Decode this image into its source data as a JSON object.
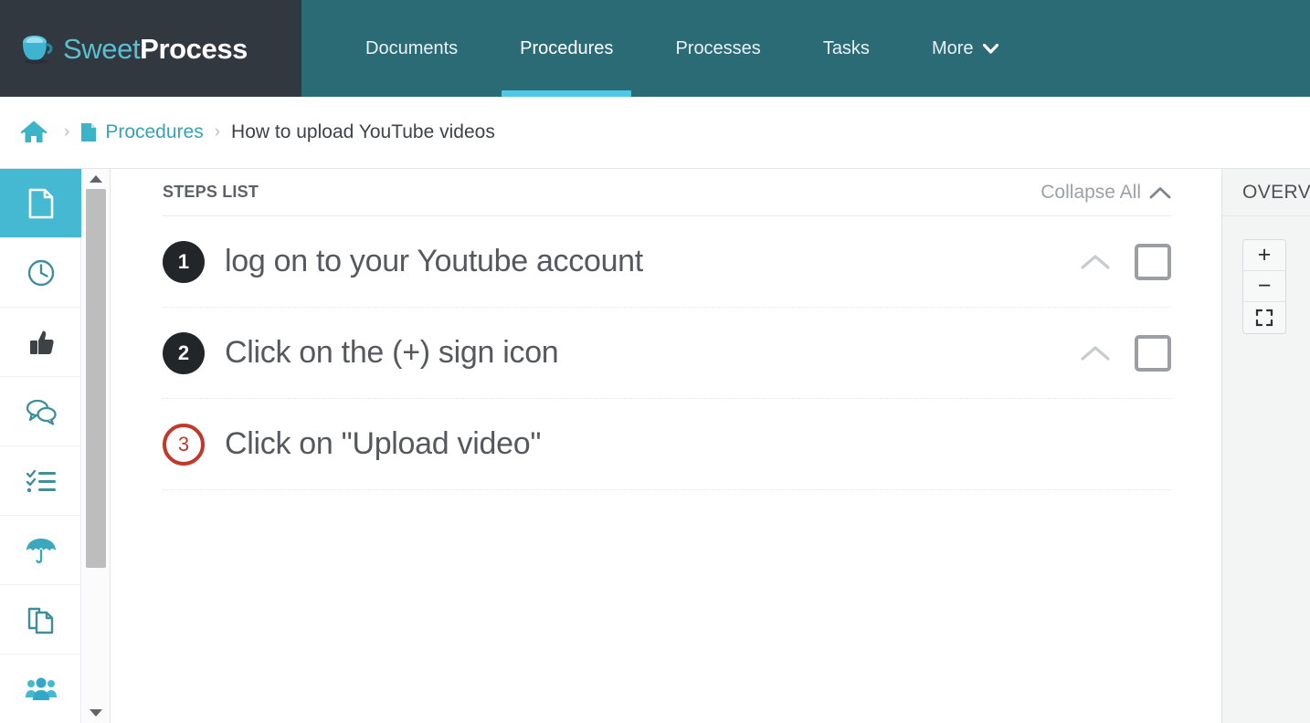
{
  "brand": {
    "name_part1": "Sweet",
    "name_part2": "Process",
    "cup_icon": "coffee-cup-icon"
  },
  "topnav": {
    "items": [
      {
        "label": "Documents",
        "active": false
      },
      {
        "label": "Procedures",
        "active": true
      },
      {
        "label": "Processes",
        "active": false
      },
      {
        "label": "Tasks",
        "active": false
      }
    ],
    "more": {
      "label": "More",
      "chevron": "chevron-down-icon"
    }
  },
  "breadcrumb": {
    "home_icon": "home-icon",
    "separator": "›",
    "doc_icon": "document-icon",
    "section": "Procedures",
    "current": "How to upload YouTube videos"
  },
  "sidebar": {
    "items": [
      {
        "icon": "document-icon",
        "active": true
      },
      {
        "icon": "clock-icon",
        "active": false
      },
      {
        "icon": "thumbs-up-icon",
        "active": false
      },
      {
        "icon": "comments-icon",
        "active": false
      },
      {
        "icon": "checklist-icon",
        "active": false
      },
      {
        "icon": "umbrella-icon",
        "active": false
      },
      {
        "icon": "copy-pages-icon",
        "active": false
      },
      {
        "icon": "team-users-icon",
        "active": false
      }
    ],
    "scrollbar": {
      "up_arrow": "scroll-up-arrow-icon",
      "down_arrow": "scroll-down-arrow-icon"
    }
  },
  "steps_panel": {
    "title": "STEPS LIST",
    "collapse_all": {
      "label": "Collapse All",
      "icon": "chevron-up-icon"
    },
    "steps": [
      {
        "number": "1",
        "text": "log on to your Youtube account",
        "badge_style": "dark",
        "has_chevron": true,
        "has_checkbox": true
      },
      {
        "number": "2",
        "text": "Click on the (+) sign icon",
        "badge_style": "dark",
        "has_chevron": true,
        "has_checkbox": true
      },
      {
        "number": "3",
        "text": "Click on \"Upload video\"",
        "badge_style": "red",
        "has_chevron": false,
        "has_checkbox": false
      }
    ]
  },
  "overview_panel": {
    "title": "OVERVIEW",
    "zoom_controls": [
      {
        "label": "+",
        "name": "zoom-in-button"
      },
      {
        "label": "−",
        "name": "zoom-out-button"
      },
      {
        "label": "",
        "name": "fit-screen-button"
      }
    ]
  },
  "colors": {
    "nav_teal": "#2b6b75",
    "brand_dark": "#313840",
    "accent_cyan": "#4ec8e4",
    "sidebar_active": "#45b9d1",
    "link_teal": "#38a2b5",
    "badge_dark": "#222628",
    "badge_red": "#c0392b",
    "text_gray": "#55595d",
    "overview_bg": "#f3f4f4"
  }
}
